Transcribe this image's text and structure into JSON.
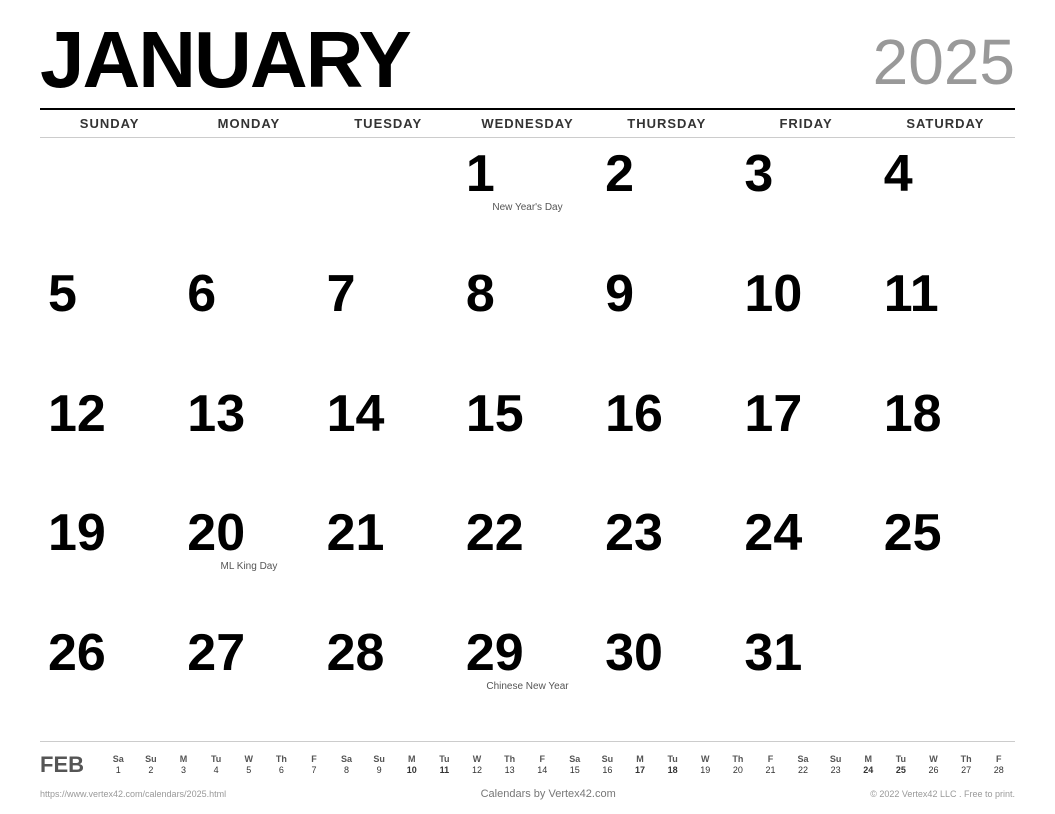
{
  "header": {
    "month": "JANUARY",
    "year": "2025"
  },
  "day_headers": [
    "SUNDAY",
    "MONDAY",
    "TUESDAY",
    "WEDNESDAY",
    "THURSDAY",
    "FRIDAY",
    "SATURDAY"
  ],
  "weeks": [
    [
      {
        "day": "",
        "empty": true
      },
      {
        "day": "",
        "empty": true
      },
      {
        "day": "",
        "empty": true
      },
      {
        "day": "1",
        "holiday": "New Year's Day"
      },
      {
        "day": "2"
      },
      {
        "day": "3"
      },
      {
        "day": "4"
      }
    ],
    [
      {
        "day": "5"
      },
      {
        "day": "6"
      },
      {
        "day": "7"
      },
      {
        "day": "8"
      },
      {
        "day": "9"
      },
      {
        "day": "10"
      },
      {
        "day": "11"
      }
    ],
    [
      {
        "day": "12"
      },
      {
        "day": "13"
      },
      {
        "day": "14"
      },
      {
        "day": "15"
      },
      {
        "day": "16"
      },
      {
        "day": "17"
      },
      {
        "day": "18"
      }
    ],
    [
      {
        "day": "19"
      },
      {
        "day": "20",
        "holiday": "ML King Day"
      },
      {
        "day": "21"
      },
      {
        "day": "22"
      },
      {
        "day": "23"
      },
      {
        "day": "24"
      },
      {
        "day": "25"
      }
    ],
    [
      {
        "day": "26"
      },
      {
        "day": "27"
      },
      {
        "day": "28"
      },
      {
        "day": "29",
        "holiday": "Chinese New Year"
      },
      {
        "day": "30"
      },
      {
        "day": "31"
      },
      {
        "day": "",
        "empty": true
      }
    ]
  ],
  "mini_calendar": {
    "month_label": "FEB",
    "day_headers": [
      "Sa",
      "Su",
      "M",
      "Tu",
      "W",
      "Th",
      "F",
      "Sa",
      "Su",
      "M",
      "Tu",
      "W",
      "Th",
      "F",
      "Sa",
      "Su",
      "M",
      "Tu",
      "W",
      "Th",
      "F",
      "Sa",
      "Su",
      "M",
      "Tu",
      "W",
      "Th",
      "F"
    ],
    "days": [
      "1",
      "2",
      "3",
      "4",
      "5",
      "6",
      "7",
      "8",
      "9",
      "10",
      "11",
      "12",
      "13",
      "14",
      "15",
      "16",
      "17",
      "18",
      "19",
      "20",
      "21",
      "22",
      "23",
      "24",
      "25",
      "26",
      "27",
      "28"
    ],
    "bold_days": [
      "10",
      "11",
      "17",
      "18",
      "24",
      "25"
    ]
  },
  "footer": {
    "left": "https://www.vertex42.com/calendars/2025.html",
    "center": "Calendars by Vertex42.com",
    "right": "© 2022 Vertex42 LLC . Free to print."
  }
}
